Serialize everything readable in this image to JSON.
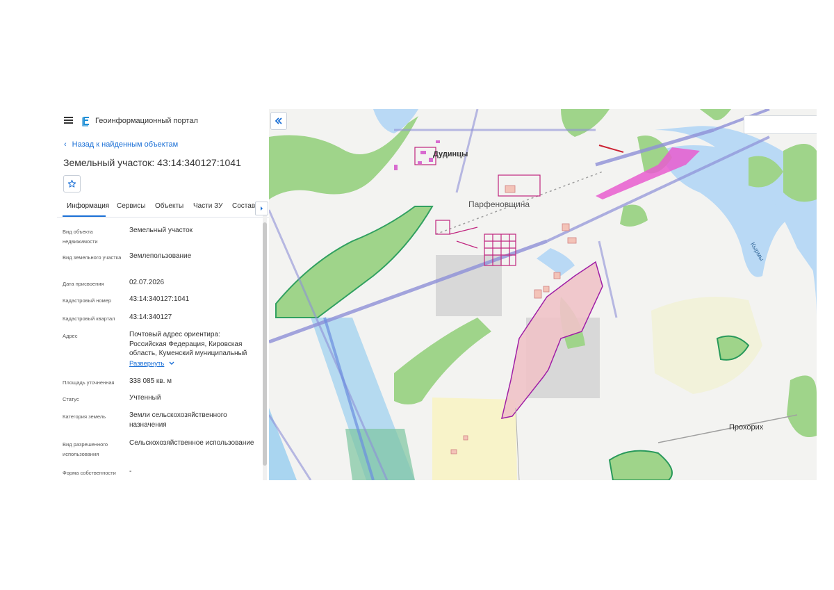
{
  "app": {
    "title": "Геоинформационный портал",
    "icons": {
      "menu": "hamburger-icon",
      "logo": "portal-logo-icon",
      "favorite": "star-icon",
      "collapse": "double-chevron-left-icon"
    }
  },
  "nav": {
    "back_label": "Назад к найденным объектам"
  },
  "object": {
    "title": "Земельный участок: 43:14:340127:1041"
  },
  "tabs": [
    {
      "label": "Информация",
      "active": true
    },
    {
      "label": "Сервисы"
    },
    {
      "label": "Объекты"
    },
    {
      "label": "Части ЗУ"
    },
    {
      "label": "Состав"
    }
  ],
  "properties": [
    {
      "label": "Вид объекта недвижимости",
      "value": "Земельный участок"
    },
    {
      "label": "Вид земельного участка",
      "value": "Землепользование"
    },
    {
      "label": "Дата присвоения",
      "value": "02.07.2026"
    },
    {
      "label": "Кадастровый номер",
      "value": "43:14:340127:1041"
    },
    {
      "label": "Кадастровый квартал",
      "value": "43:14:340127"
    },
    {
      "label": "Адрес",
      "value": "Почтовый адрес ориентира: Российская Федерация, Кировская область, Куменский муниципальный",
      "expand_label": "Развернуть"
    },
    {
      "label": "Площадь уточненная",
      "value": "338 085 кв. м"
    },
    {
      "label": "Статус",
      "value": "Учтенный"
    },
    {
      "label": "Категория земель",
      "value": "Земли сельскохозяйственного назначения"
    },
    {
      "label": "Вид разрешенного использования",
      "value": "Сельскохозяйственное использование"
    },
    {
      "label": "Форма собственности",
      "value": "-"
    }
  ],
  "map": {
    "labels": {
      "village1": "Дудинцы",
      "village2": "Парфеновщина",
      "village3": "Прохорих",
      "river": "Кырмы"
    },
    "colors": {
      "forest": "#9fd48a",
      "water": "#b5d6f2",
      "parcel_fill": "#efc3c8",
      "parcel_stroke": "#a01fa6",
      "field_yellow": "#f7f2c7",
      "rail": "#8e90d8"
    }
  }
}
